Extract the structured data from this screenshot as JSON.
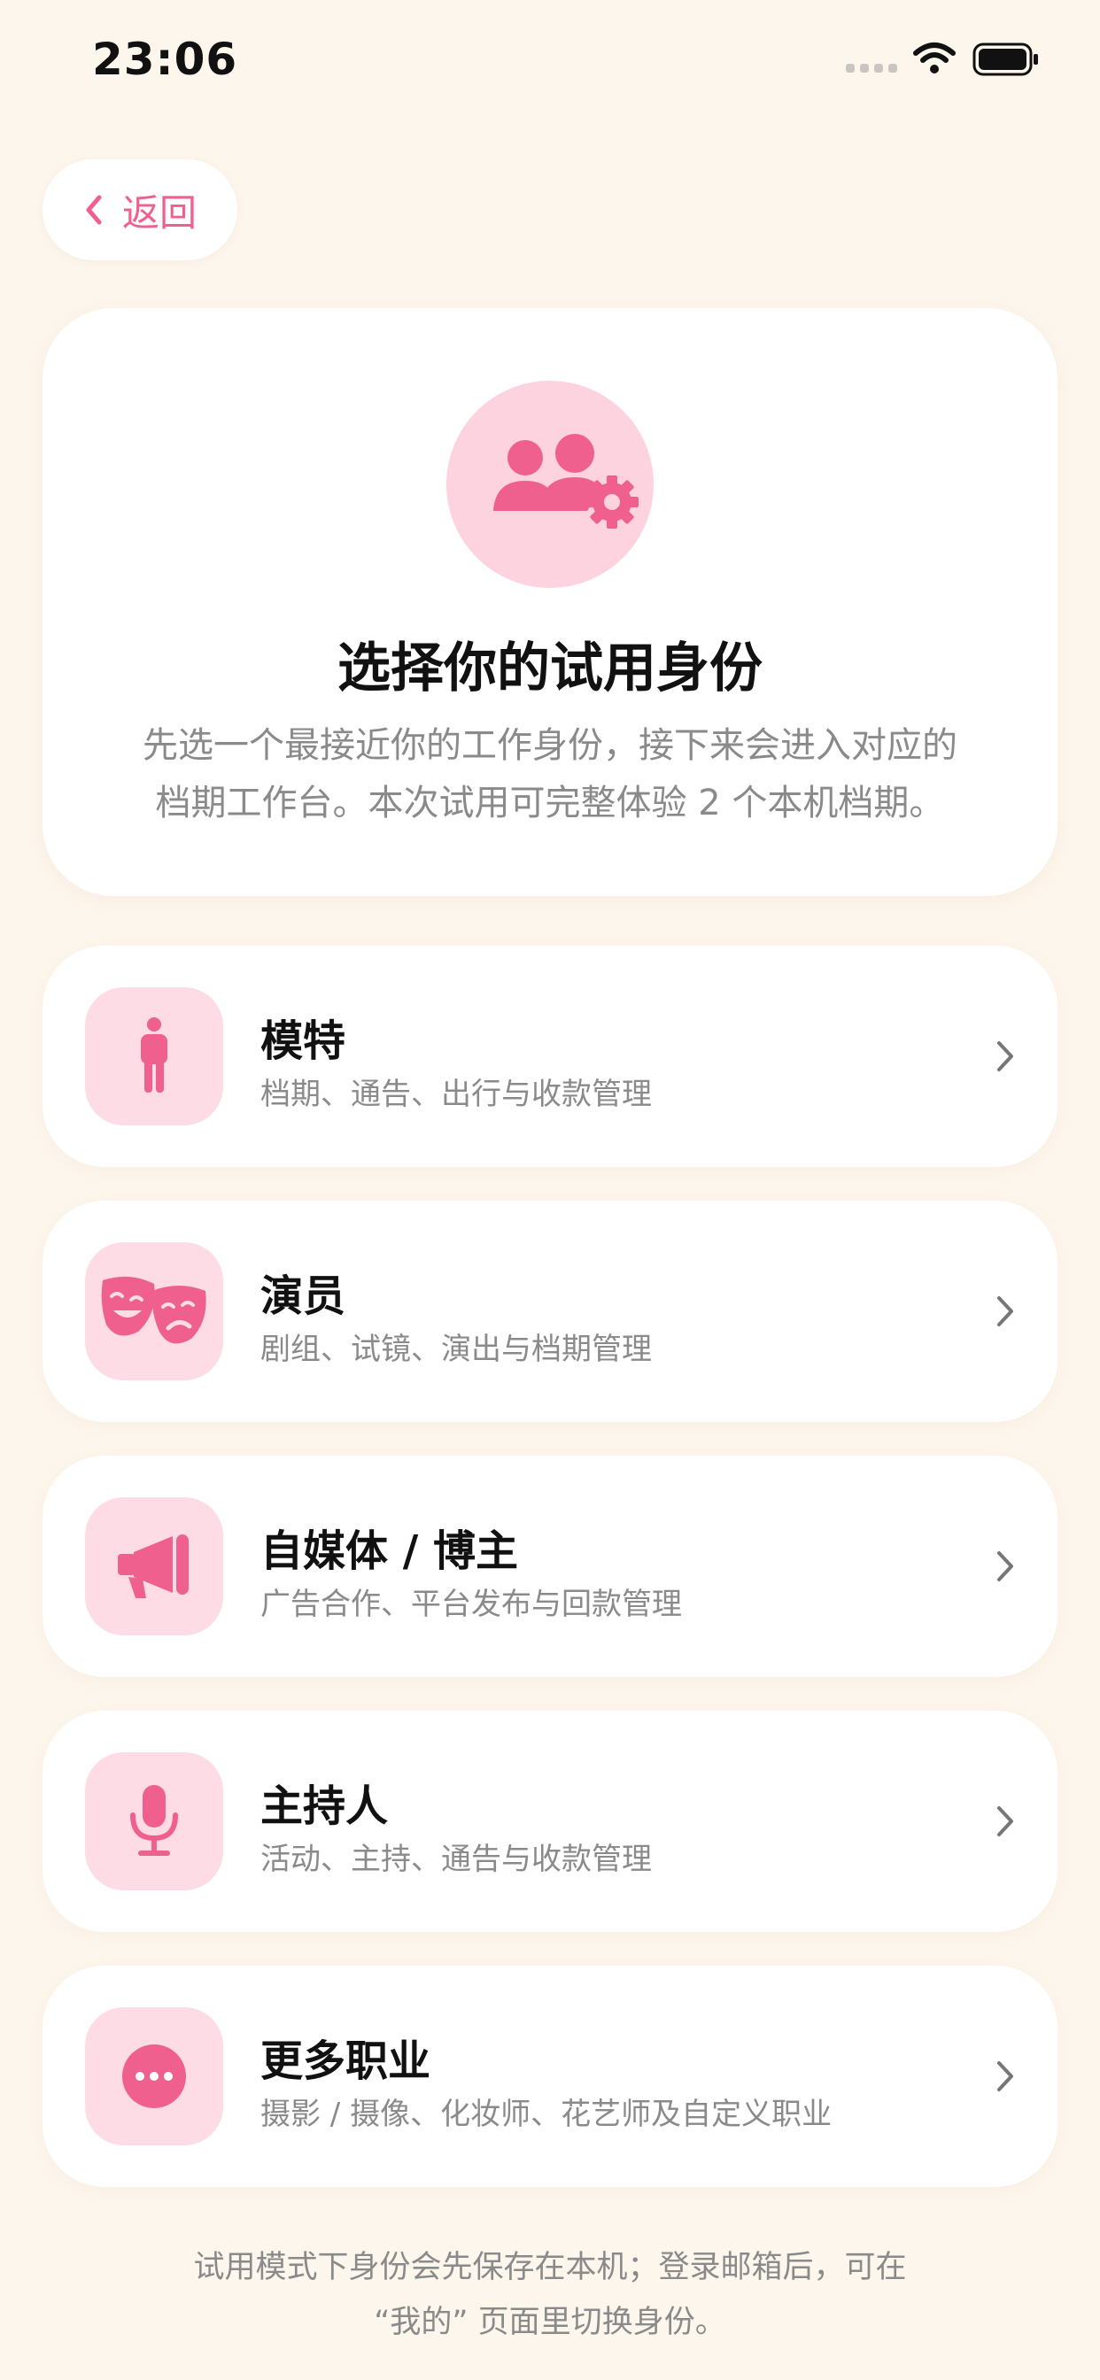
{
  "status_bar": {
    "time": "23:06"
  },
  "nav": {
    "back_label": "返回"
  },
  "hero": {
    "icon": "users-gear-icon",
    "title": "选择你的试用身份",
    "description_line1": "先选一个最接近你的工作身份，接下来会进入对应的",
    "description_line2": "档期工作台。本次试用可完整体验 2 个本机档期。"
  },
  "roles": [
    {
      "icon": "person-icon",
      "title": "模特",
      "subtitle": "档期、通告、出行与收款管理"
    },
    {
      "icon": "theater-masks-icon",
      "title": "演员",
      "subtitle": "剧组、试镜、演出与档期管理"
    },
    {
      "icon": "megaphone-icon",
      "title": "自媒体 / 博主",
      "subtitle": "广告合作、平台发布与回款管理"
    },
    {
      "icon": "microphone-icon",
      "title": "主持人",
      "subtitle": "活动、主持、通告与收款管理"
    },
    {
      "icon": "more-dots-icon",
      "title": "更多职业",
      "subtitle": "摄影 / 摄像、化妆师、花艺师及自定义职业"
    }
  ],
  "footer": {
    "line1": "试用模式下身份会先保存在本机；登录邮箱后，可在",
    "line2": "“我的” 页面里切换身份。"
  },
  "colors": {
    "background": "#FDF6EC",
    "accent": "#F0608E",
    "icon_bg": "#FDDCE6",
    "card": "#FFFFFF"
  }
}
